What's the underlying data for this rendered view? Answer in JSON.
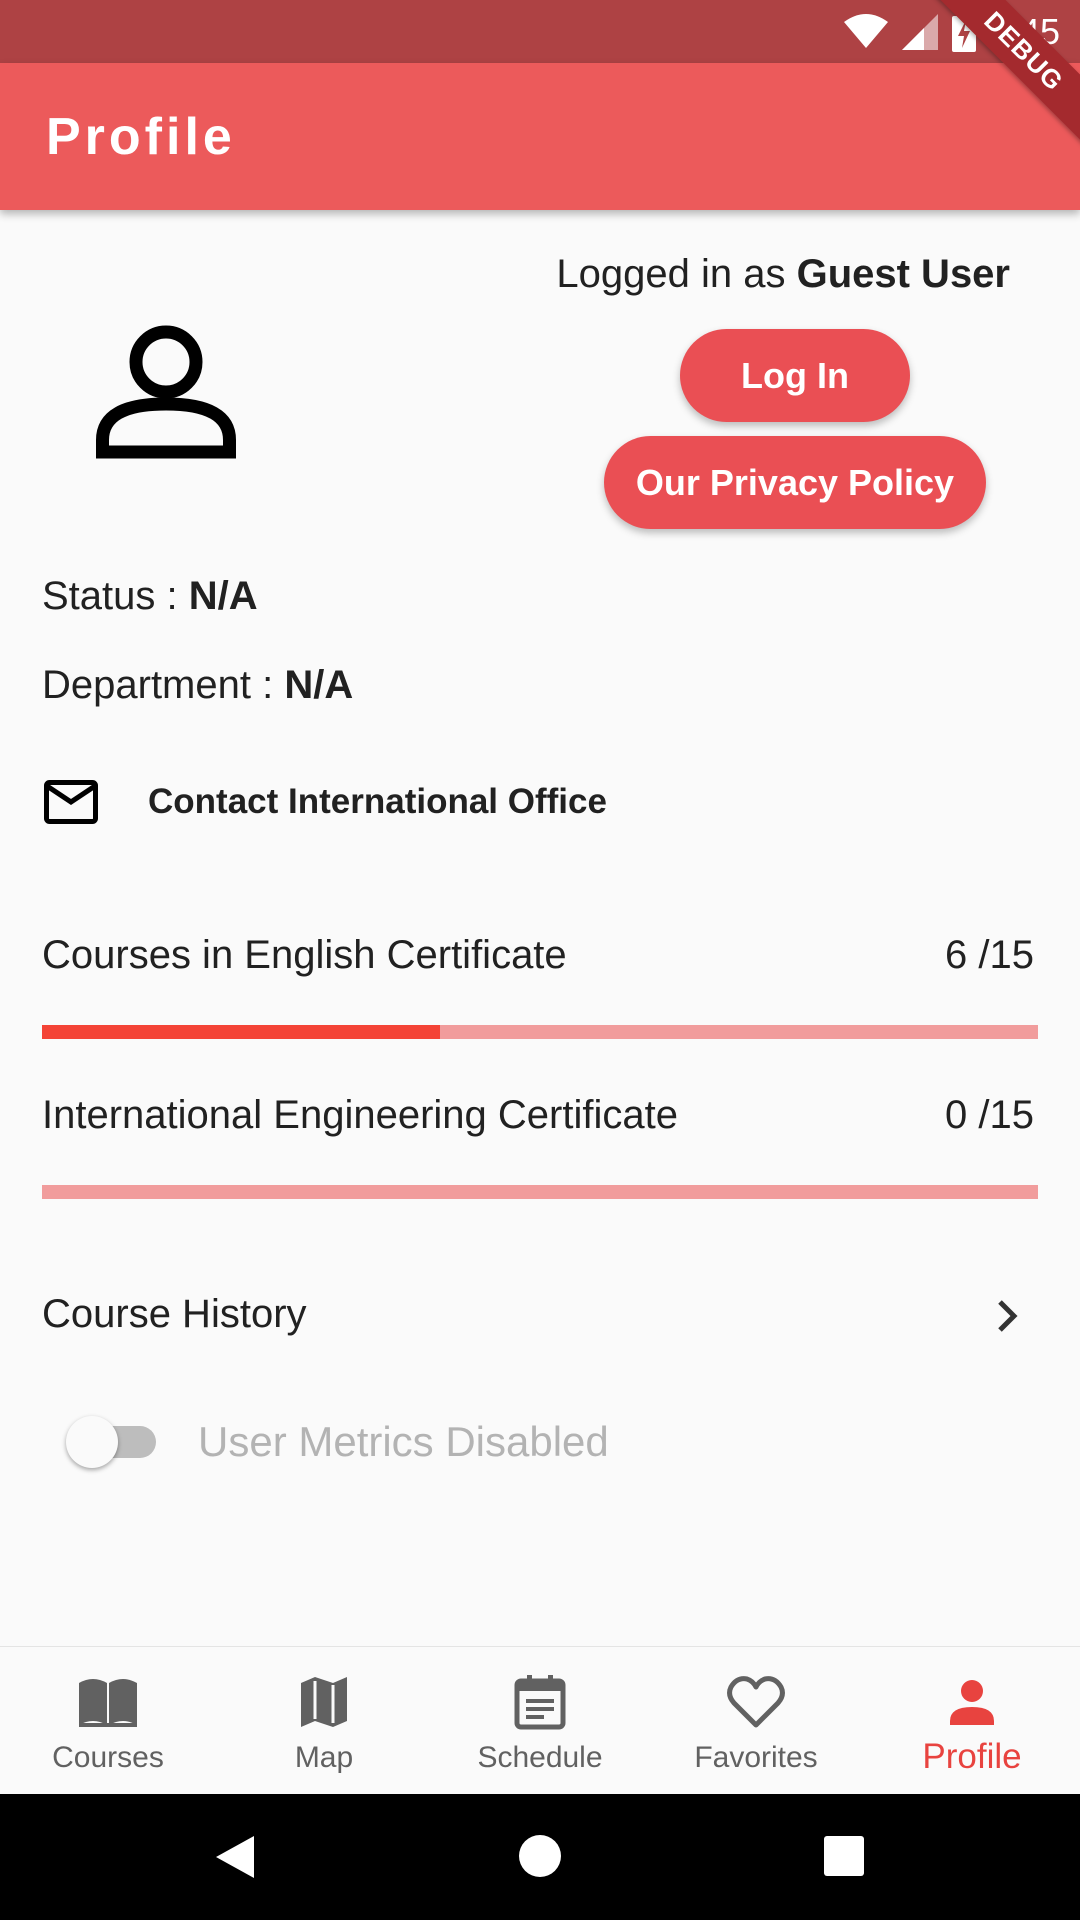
{
  "status_bar": {
    "time": "9:45"
  },
  "app_bar": {
    "title": "Profile",
    "debug_label": "DEBUG"
  },
  "profile": {
    "logged_in_prefix": "Logged in as",
    "user_name": "Guest User",
    "login_button": "Log In",
    "privacy_button": "Our Privacy Policy",
    "status_label": "Status :",
    "status_value": "N/A",
    "department_label": "Department :",
    "department_value": "N/A",
    "contact_label": "Contact International Office"
  },
  "certificates": [
    {
      "label": "Courses in English Certificate",
      "count": "6 /15",
      "progress": 0.4
    },
    {
      "label": "International Engineering Certificate",
      "count": "0 /15",
      "progress": 0.0
    }
  ],
  "course_history": {
    "label": "Course History"
  },
  "metrics_toggle": {
    "label": "User Metrics Disabled",
    "enabled": false
  },
  "bottom_nav": {
    "items": [
      {
        "label": "Courses",
        "icon": "book-icon",
        "active": false
      },
      {
        "label": "Map",
        "icon": "map-icon",
        "active": false
      },
      {
        "label": "Schedule",
        "icon": "calendar-icon",
        "active": false
      },
      {
        "label": "Favorites",
        "icon": "heart-icon",
        "active": false
      },
      {
        "label": "Profile",
        "icon": "person-icon",
        "active": true
      }
    ]
  },
  "colors": {
    "app_bar": "#ec5a5b",
    "status_bar": "#ae4244",
    "accent": "#ea4f54",
    "progress_fill": "#f44336",
    "progress_track": "#f19c9c",
    "nav_active": "#e8433f"
  }
}
